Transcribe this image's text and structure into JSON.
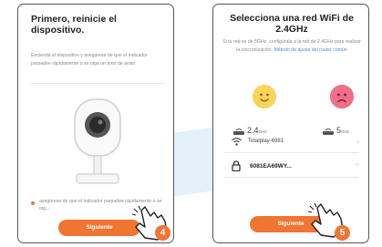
{
  "step4": {
    "title": "Primero, reinicie el dispositivo.",
    "instructions": "Encienda el dispositivo y asegúrese de que el indicador parpadee rápidamente o se oiga un tono de aviso",
    "radio_label": "asegúrese de que el indicador parpadee rápidamente o se oig...",
    "next_label": "Siguiente",
    "badge": "4"
  },
  "step5": {
    "title": "Selecciona una red WiFi de 2.4GHz",
    "info": "Si tu red es de 5GHz, configúrala a la red de 2.4GHz para realizar la sincronización.",
    "info_link": "Método de ajuste del router común",
    "band_2g": "2.4",
    "band_2g_unit": "GHz",
    "band_5g": "5",
    "band_5g_unit": "GHz",
    "wifi_name": "Totalplay-6981",
    "password_value": "6081EA69WY...",
    "next_label": "Siguiente",
    "badge": "5"
  },
  "colors": {
    "accent": "#f07432",
    "happy": "#f6d55a",
    "sad": "#f06e87",
    "link": "#4a8fd0"
  },
  "icons": [
    "camera-illustration",
    "hand-pointer-icon",
    "router-icon",
    "wifi-icon",
    "lock-icon",
    "chevron-right-icon",
    "happy-face-icon",
    "sad-face-icon"
  ]
}
